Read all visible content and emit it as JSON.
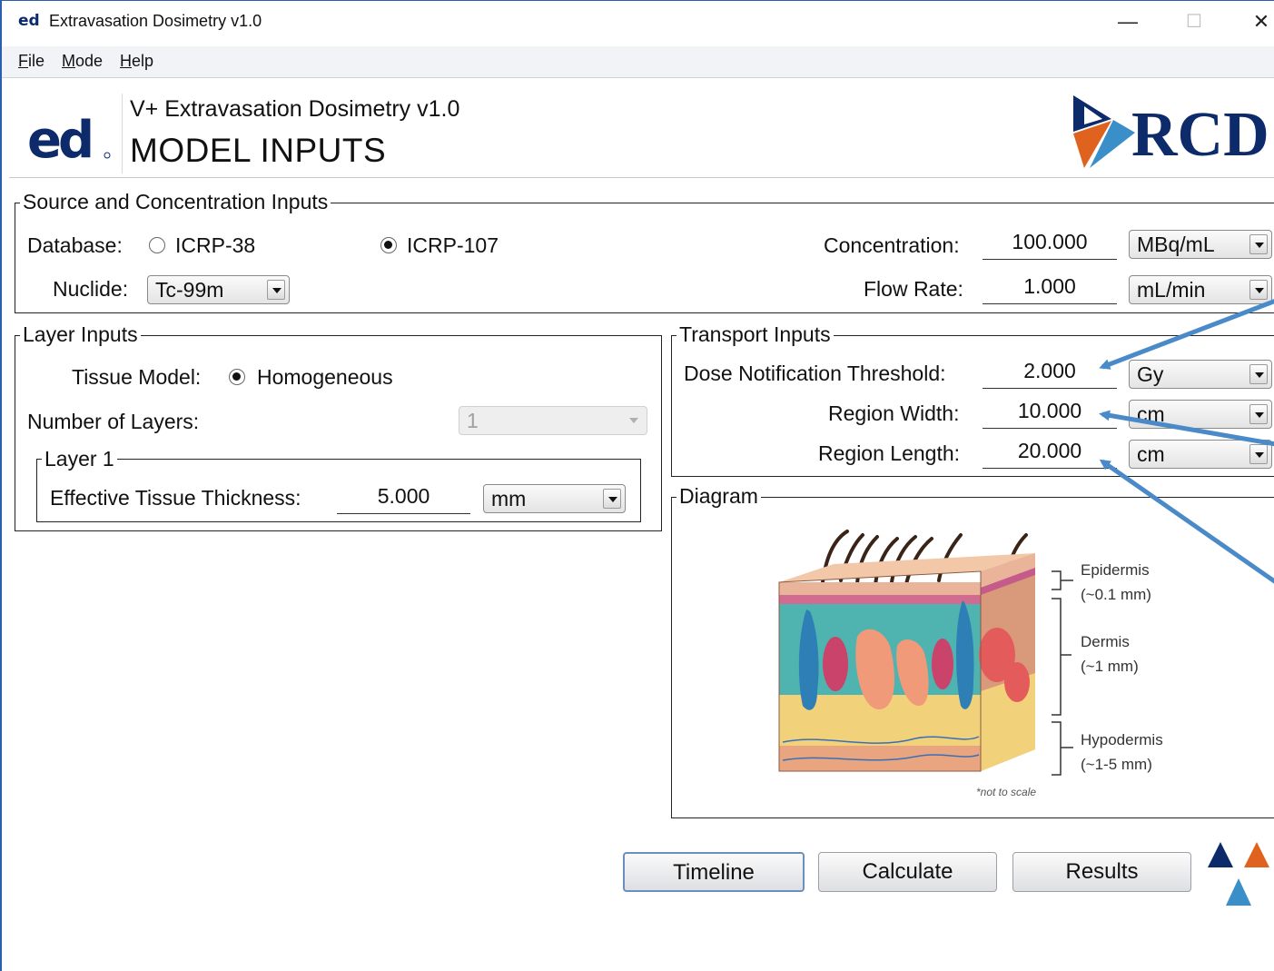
{
  "window": {
    "icon_text": "ed",
    "title": "Extravasation Dosimetry v1.0",
    "minimize": "—",
    "maximize": "☐",
    "close": "✕"
  },
  "menu": {
    "file": {
      "mnemonic": "F",
      "rest": "ile"
    },
    "mode": {
      "mnemonic": "M",
      "rest": "ode"
    },
    "help": {
      "mnemonic": "H",
      "rest": "elp"
    }
  },
  "header": {
    "subtitle": "V+ Extravasation Dosimetry v1.0",
    "title": "MODEL INPUTS",
    "logo_text": "ed",
    "brand": "RCD"
  },
  "source": {
    "legend": "Source and Concentration Inputs",
    "database_label": "Database:",
    "db_option_1": "ICRP-38",
    "db_option_2": "ICRP-107",
    "db_selected": "ICRP-107",
    "nuclide_label": "Nuclide:",
    "nuclide_value": "Tc-99m",
    "concentration_label": "Concentration:",
    "concentration_value": "100.000",
    "concentration_unit": "MBq/mL",
    "flow_label": "Flow Rate:",
    "flow_value": "1.000",
    "flow_unit": "mL/min"
  },
  "layers": {
    "legend": "Layer Inputs",
    "tissue_label": "Tissue Model:",
    "tissue_option": "Homogeneous",
    "num_layers_label": "Number of Layers:",
    "num_layers_value": "1",
    "layer1_legend": "Layer 1",
    "thickness_label": "Effective Tissue Thickness:",
    "thickness_value": "5.000",
    "thickness_unit": "mm"
  },
  "transport": {
    "legend": "Transport Inputs",
    "dose_label": "Dose Notification Threshold:",
    "dose_value": "2.000",
    "dose_unit": "Gy",
    "width_label": "Region Width:",
    "width_value": "10.000",
    "width_unit": "cm",
    "length_label": "Region Length:",
    "length_value": "20.000",
    "length_unit": "cm"
  },
  "diagram": {
    "legend": "Diagram",
    "epidermis": "Epidermis",
    "epidermis_size": "(~0.1 mm)",
    "dermis": "Dermis",
    "dermis_size": "(~1 mm)",
    "hypodermis": "Hypodermis",
    "hypodermis_size": "(~1-5 mm)",
    "note": "*not to scale"
  },
  "buttons": {
    "timeline": "Timeline",
    "calculate": "Calculate",
    "results": "Results"
  },
  "colors": {
    "arrow": "#4a8ac8",
    "brand_navy": "#0d2a6b",
    "brand_orange": "#e0621f",
    "brand_blue": "#3a8fc9"
  }
}
